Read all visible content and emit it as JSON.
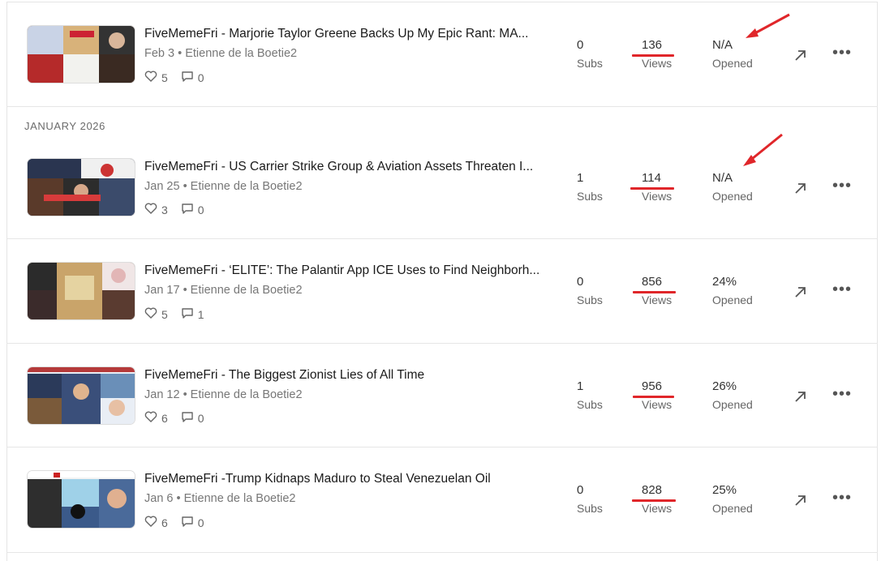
{
  "section_label": "JANUARY 2026",
  "labels": {
    "subs": "Subs",
    "views": "Views",
    "opened": "Opened"
  },
  "annotation_color": "#e0262a",
  "posts": [
    {
      "title": "FiveMemeFri - Marjorie Taylor Greene Backs Up My Epic Rant: MA...",
      "meta": "Feb 3 • Etienne de la Boetie2",
      "likes": "5",
      "comments": "0",
      "subs": "0",
      "views": "136",
      "opened": "N/A"
    },
    {
      "title": "FiveMemeFri - US Carrier Strike Group & Aviation Assets Threaten I...",
      "meta": "Jan 25 • Etienne de la Boetie2",
      "likes": "3",
      "comments": "0",
      "subs": "1",
      "views": "114",
      "opened": "N/A"
    },
    {
      "title": "FiveMemeFri - ‘ELITE’: The Palantir App ICE Uses to Find Neighborh...",
      "meta": "Jan 17 • Etienne de la Boetie2",
      "likes": "5",
      "comments": "1",
      "subs": "0",
      "views": "856",
      "opened": "24%"
    },
    {
      "title": "FiveMemeFri - The Biggest Zionist Lies of All Time",
      "meta": "Jan 12 • Etienne de la Boetie2",
      "likes": "6",
      "comments": "0",
      "subs": "1",
      "views": "956",
      "opened": "26%"
    },
    {
      "title": "FiveMemeFri -Trump Kidnaps Maduro to Steal Venezuelan Oil",
      "meta": "Jan 6 • Etienne de la Boetie2",
      "likes": "6",
      "comments": "0",
      "subs": "0",
      "views": "828",
      "opened": "25%"
    }
  ]
}
